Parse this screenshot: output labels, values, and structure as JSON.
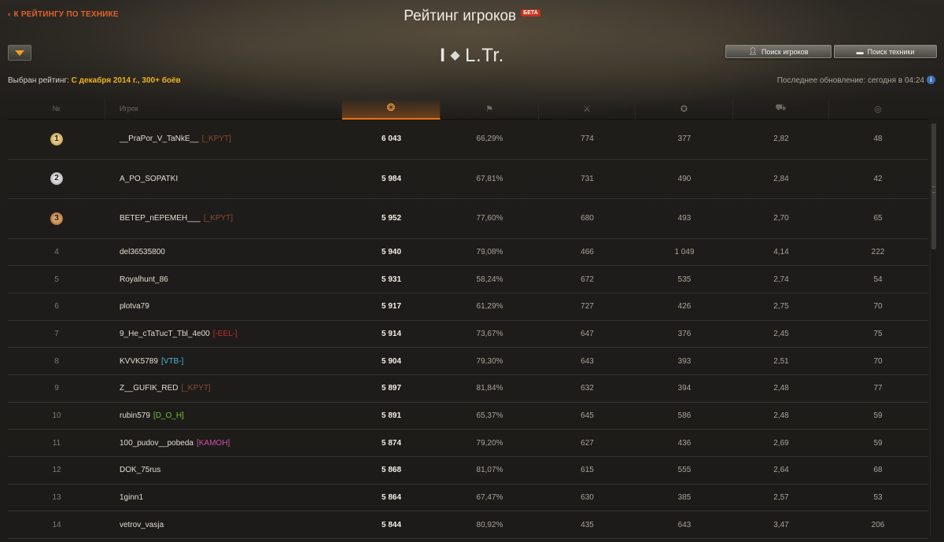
{
  "header": {
    "back_link": "К РЕЙТИНГУ ПО ТЕХНИКЕ",
    "title": "Рейтинг игроков",
    "beta": "БЕТА",
    "vehicle_tier": "I",
    "vehicle_class": "L.Tr.",
    "selected_rating_label": "Выбран рейтинг:",
    "selected_rating_value": "С декабря 2014 г., 300+ боёв",
    "search_players": "Поиск игроков",
    "search_vehicles": "Поиск техники",
    "last_update": "Последнее обновление: сегодня в 04:24"
  },
  "columns": {
    "rank": "№",
    "player": "Игрок",
    "rating_icon": "laurel-rating-icon",
    "win_icon": "flag-icon",
    "battles_icon": "crossed-swords-icon",
    "damage_icon": "star-burst-icon",
    "kd_icon": "tank-kill-icon",
    "spot_icon": "eye-spot-icon"
  },
  "rows": [
    {
      "rank": "1",
      "name": "__PraPor_V_TaNkE__",
      "clan": "[_KPYT]",
      "clan_color": "#8a4a3a",
      "rating": "6 043",
      "win": "66,29%",
      "battles": "774",
      "damage": "377",
      "kd": "2,82",
      "spot": "48"
    },
    {
      "rank": "2",
      "name": "A_PO_SOPATKI",
      "clan": "",
      "clan_color": "",
      "rating": "5 984",
      "win": "67,81%",
      "battles": "731",
      "damage": "490",
      "kd": "2,84",
      "spot": "42"
    },
    {
      "rank": "3",
      "name": "BETEP_nEPEMEH___",
      "clan": "[_KPYT]",
      "clan_color": "#8a4a3a",
      "rating": "5 952",
      "win": "77,60%",
      "battles": "680",
      "damage": "493",
      "kd": "2,70",
      "spot": "65"
    },
    {
      "rank": "4",
      "name": "del36535800",
      "clan": "",
      "clan_color": "",
      "rating": "5 940",
      "win": "79,08%",
      "battles": "466",
      "damage": "1 049",
      "kd": "4,14",
      "spot": "222"
    },
    {
      "rank": "5",
      "name": "Royalhunt_86",
      "clan": "",
      "clan_color": "",
      "rating": "5 931",
      "win": "58,24%",
      "battles": "672",
      "damage": "535",
      "kd": "2,74",
      "spot": "54"
    },
    {
      "rank": "6",
      "name": "plotva79",
      "clan": "",
      "clan_color": "",
      "rating": "5 917",
      "win": "61,29%",
      "battles": "727",
      "damage": "426",
      "kd": "2,75",
      "spot": "70"
    },
    {
      "rank": "7",
      "name": "9_He_cTaTucT_Tbl_4e00",
      "clan": "[-EEL-]",
      "clan_color": "#c0302a",
      "rating": "5 914",
      "win": "73,67%",
      "battles": "647",
      "damage": "376",
      "kd": "2,45",
      "spot": "75"
    },
    {
      "rank": "8",
      "name": "KVVK5789",
      "clan": "[VTB-]",
      "clan_color": "#4fb7d8",
      "rating": "5 904",
      "win": "79,30%",
      "battles": "643",
      "damage": "393",
      "kd": "2,51",
      "spot": "70"
    },
    {
      "rank": "9",
      "name": "Z__GUFIK_RED",
      "clan": "[_KPYT]",
      "clan_color": "#8a4a3a",
      "rating": "5 897",
      "win": "81,84%",
      "battles": "632",
      "damage": "394",
      "kd": "2,48",
      "spot": "77"
    },
    {
      "rank": "10",
      "name": "rubin579",
      "clan": "[D_O_H]",
      "clan_color": "#6fc23a",
      "rating": "5 891",
      "win": "65,37%",
      "battles": "645",
      "damage": "586",
      "kd": "2,48",
      "spot": "59"
    },
    {
      "rank": "11",
      "name": "100_pudov__pobeda",
      "clan": "[KAMOH]",
      "clan_color": "#d04fa8",
      "rating": "5 874",
      "win": "79,20%",
      "battles": "627",
      "damage": "436",
      "kd": "2,69",
      "spot": "59"
    },
    {
      "rank": "12",
      "name": "DOK_75rus",
      "clan": "",
      "clan_color": "",
      "rating": "5 868",
      "win": "81,07%",
      "battles": "615",
      "damage": "555",
      "kd": "2,64",
      "spot": "68"
    },
    {
      "rank": "13",
      "name": "1ginn1",
      "clan": "",
      "clan_color": "",
      "rating": "5 864",
      "win": "67,47%",
      "battles": "630",
      "damage": "385",
      "kd": "2,57",
      "spot": "53"
    },
    {
      "rank": "14",
      "name": "vetrov_vasja",
      "clan": "",
      "clan_color": "",
      "rating": "5 844",
      "win": "80,92%",
      "battles": "435",
      "damage": "643",
      "kd": "3,47",
      "spot": "206"
    }
  ]
}
